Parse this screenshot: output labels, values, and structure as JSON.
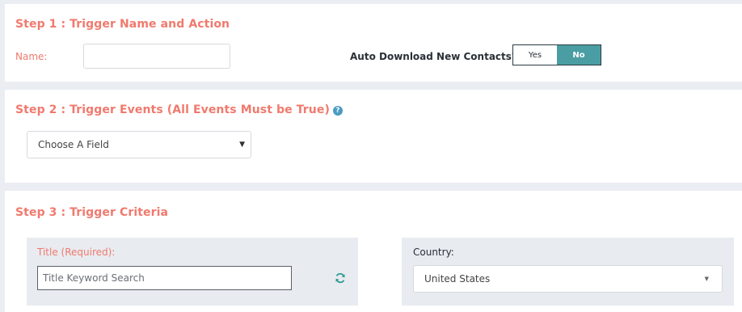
{
  "step1": {
    "title": "Step 1 : Trigger Name and Action",
    "name_label": "Name:",
    "name_value": "",
    "auto_download_label": "Auto Download New Contacts?",
    "toggle": {
      "yes_label": "Yes",
      "no_label": "No",
      "selected": "No"
    }
  },
  "step2": {
    "title": "Step 2 : Trigger Events (All Events Must be True)",
    "help_icon": "?",
    "field_select": {
      "selected": "Choose A Field"
    }
  },
  "step3": {
    "title": "Step 3 : Trigger Criteria",
    "title_field": {
      "label": "Title (Required):",
      "placeholder": "Title Keyword Search",
      "value": ""
    },
    "country_field": {
      "label": "Country:",
      "selected": "United States"
    }
  },
  "colors": {
    "accent_red": "#f07a6e",
    "toggle_selected": "#4a9ea3",
    "help_icon": "#4a9bc1",
    "refresh_icon": "#2e9a93"
  },
  "icons": [
    "question-circle-icon",
    "dropdown-arrow-icon",
    "refresh-icon"
  ]
}
